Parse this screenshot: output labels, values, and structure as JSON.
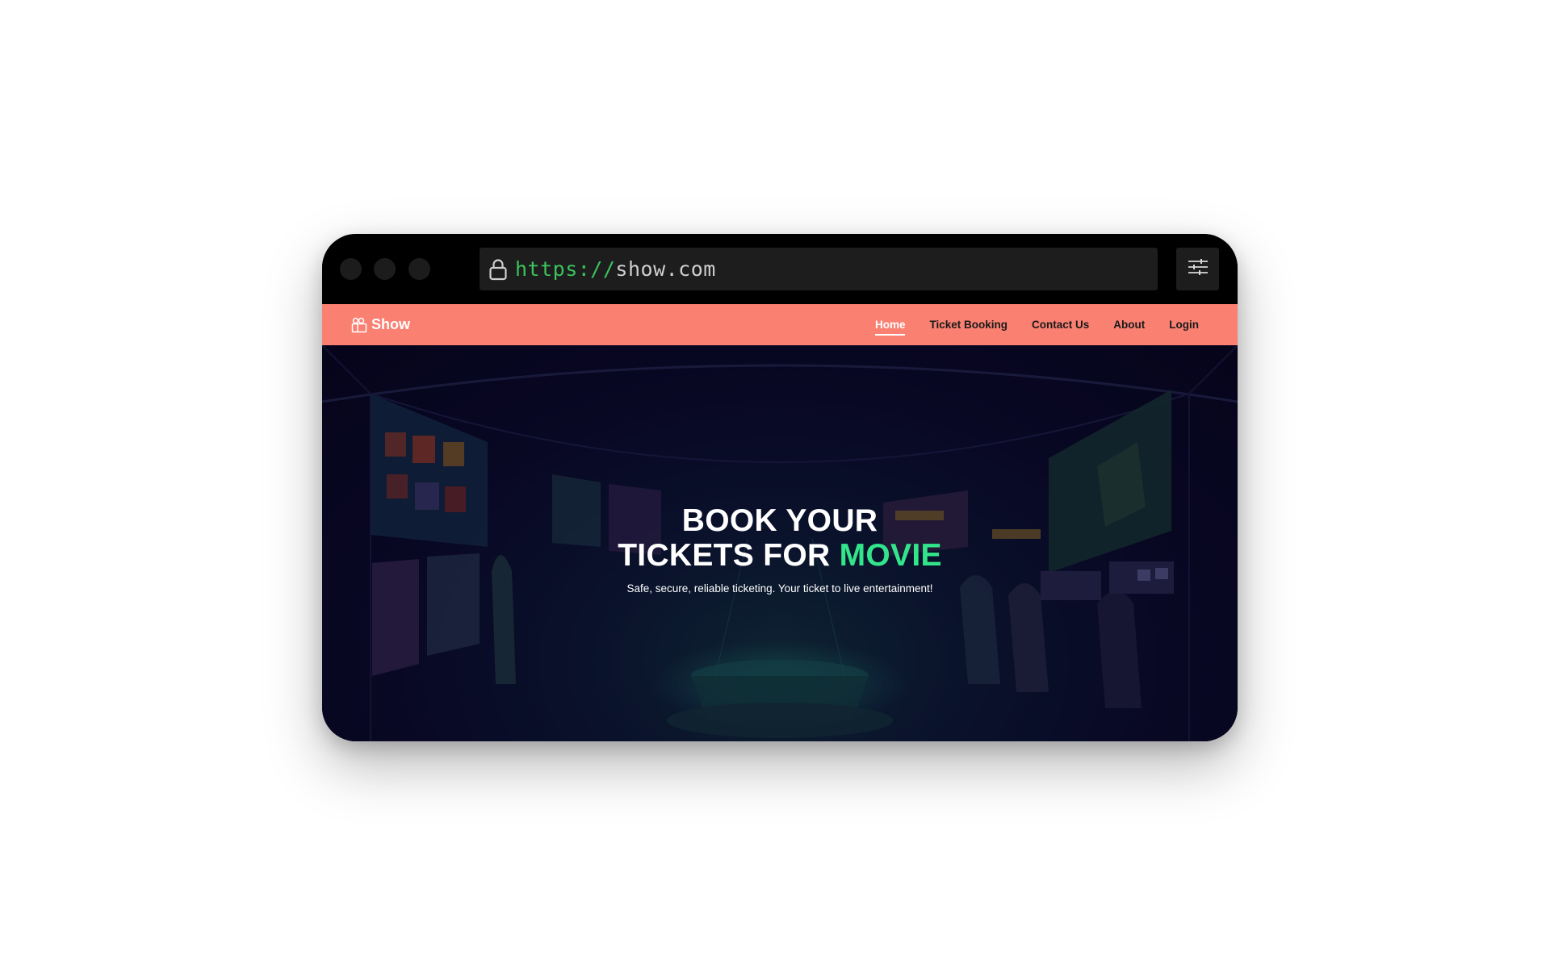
{
  "browser": {
    "url_scheme": "https://",
    "url_host": "show.com"
  },
  "navbar": {
    "brand": "Show",
    "links": [
      {
        "label": "Home",
        "active": true
      },
      {
        "label": "Ticket Booking",
        "active": false
      },
      {
        "label": "Contact Us",
        "active": false
      },
      {
        "label": "About",
        "active": false
      },
      {
        "label": "Login",
        "active": false
      }
    ],
    "background_color": "#fa8072"
  },
  "hero": {
    "title_line1": "BOOK YOUR",
    "title_line2_prefix": "TICKETS FOR ",
    "title_accent": "MOVIE",
    "subtitle": "Safe, secure, reliable ticketing. Your ticket to live entertainment!",
    "accent_color": "#33e58a"
  },
  "icons": {
    "lock": "lock-icon",
    "settings": "sliders-icon",
    "brand": "camera-icon"
  }
}
